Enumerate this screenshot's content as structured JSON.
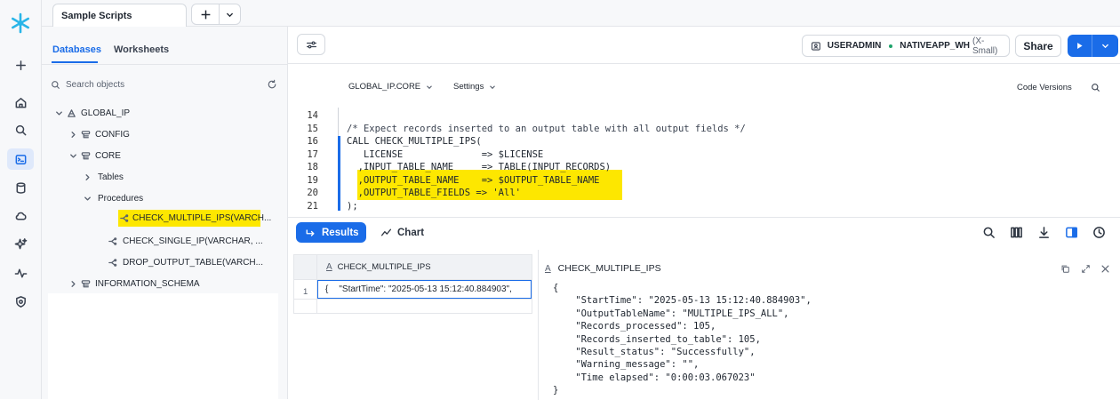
{
  "tabs": {
    "sample_scripts": "Sample Scripts"
  },
  "left_panel": {
    "tab_databases": "Databases",
    "tab_worksheets": "Worksheets",
    "search_placeholder": "Search objects",
    "tree": {
      "global_ip": "GLOBAL_IP",
      "config": "CONFIG",
      "core": "CORE",
      "tables": "Tables",
      "procedures": "Procedures",
      "proc1": "CHECK_MULTIPLE_IPS(VARCH...",
      "proc2": "CHECK_SINGLE_IP(VARCHAR, ...",
      "proc3": "DROP_OUTPUT_TABLE(VARCH...",
      "info_schema": "INFORMATION_SCHEMA"
    }
  },
  "toolbar": {
    "role": "USERADMIN",
    "warehouse": "NATIVEAPP_WH",
    "warehouse_size": "(X-Small)",
    "share": "Share"
  },
  "editor_bar": {
    "context": "GLOBAL_IP.CORE",
    "settings": "Settings",
    "code_versions": "Code Versions"
  },
  "code": {
    "lines": [
      {
        "n": "14",
        "text": ""
      },
      {
        "n": "15",
        "text": "/* Expect records inserted to an output table with all output fields */"
      },
      {
        "n": "16",
        "text": "CALL CHECK_MULTIPLE_IPS("
      },
      {
        "n": "17",
        "text": "   LICENSE              => $LICENSE"
      },
      {
        "n": "18",
        "text": "  ,INPUT_TABLE_NAME     => TABLE(INPUT_RECORDS)"
      },
      {
        "n": "19",
        "text": "  ,OUTPUT_TABLE_NAME    => $OUTPUT_TABLE_NAME"
      },
      {
        "n": "20",
        "text": "  ,OUTPUT_TABLE_FIELDS => 'All'"
      },
      {
        "n": "21",
        "text": ");"
      }
    ]
  },
  "results": {
    "results_tab": "Results",
    "chart_tab": "Chart",
    "column_header": "CHECK_MULTIPLE_IPS",
    "row_num": "1",
    "cell_open": "{",
    "cell_value": "\"StartTime\": \"2025-05-13 15:12:40.884903\",",
    "detail_title": "CHECK_MULTIPLE_IPS",
    "json_lines": [
      "{",
      "    \"StartTime\": \"2025-05-13 15:12:40.884903\",",
      "    \"OutputTableName\": \"MULTIPLE_IPS_ALL\",",
      "    \"Records_processed\": 105,",
      "    \"Records_inserted_to_table\": 105,",
      "    \"Result_status\": \"Successfully\",",
      "    \"Warning_message\": \"\",",
      "    \"Time elapsed\": \"0:00:03.067023\"",
      "}"
    ]
  },
  "colors": {
    "accent": "#1a6ce8",
    "highlight": "#fde700",
    "logo": "#29b5e8"
  }
}
